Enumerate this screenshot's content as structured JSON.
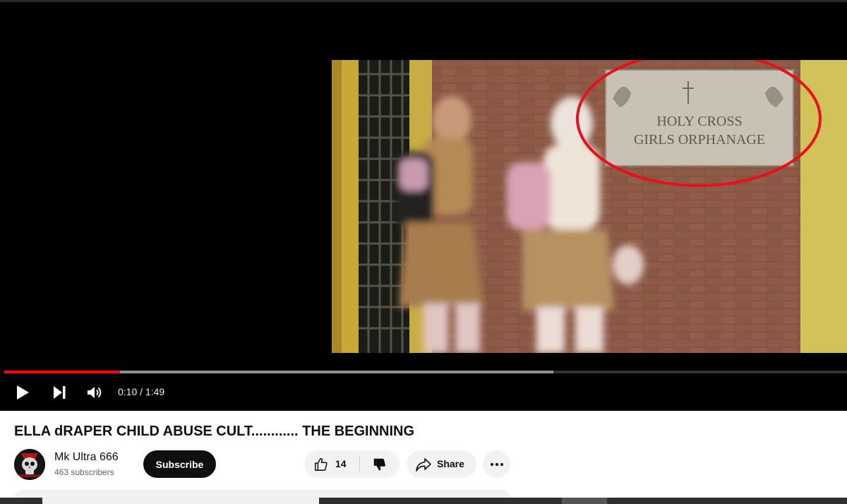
{
  "player": {
    "time_display": "0:10 / 1:49",
    "progress_fraction": 0.1376,
    "buffered_fraction": 0.6519,
    "scene": {
      "sign_line1": "HOLY CROSS",
      "sign_line2": "GIRLS ORPHANAGE",
      "annotation_color": "#e8101a"
    }
  },
  "video": {
    "title": "ELLA dRAPER CHILD ABUSE CULT............ THE BEGINNING"
  },
  "channel": {
    "name": "Mk Ultra 666",
    "subscribers": "463 subscribers",
    "subscribe_label": "Subscribe"
  },
  "actions": {
    "like_count": "14",
    "share_label": "Share"
  },
  "colors": {
    "accent": "#ff0000",
    "button_dark": "#0f0f0f",
    "pill_bg": "#f2f2f2"
  },
  "icons": {
    "play": "play-icon",
    "next": "next-icon",
    "volume": "volume-icon",
    "like": "thumbs-up-icon",
    "dislike": "thumbs-down-icon",
    "share": "share-arrow-icon",
    "more": "more-horizontal-icon"
  }
}
